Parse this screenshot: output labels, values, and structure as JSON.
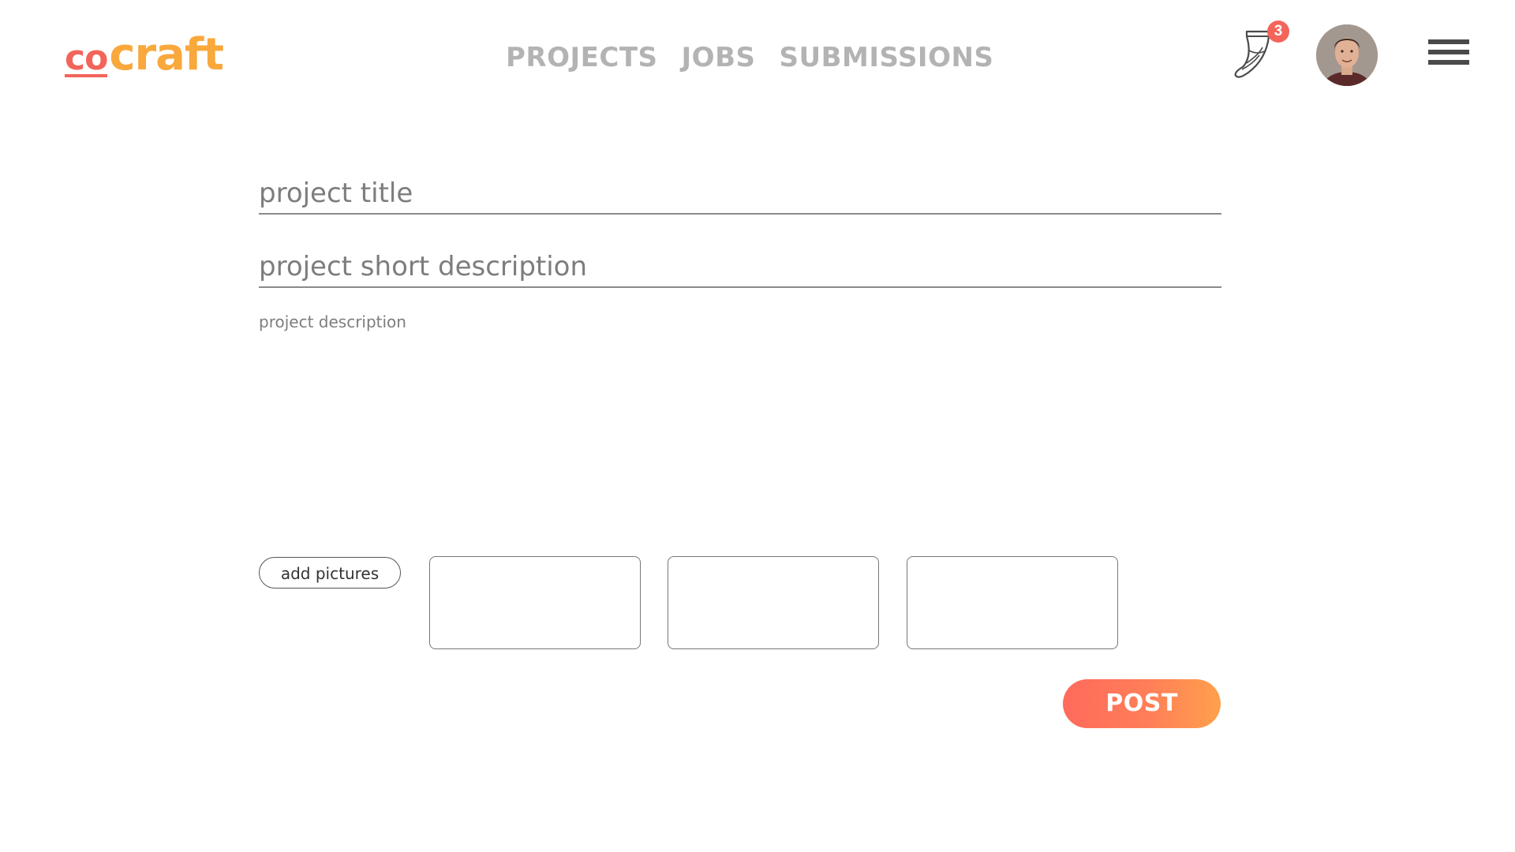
{
  "brand": {
    "logo_part1": "co",
    "logo_part2": "craft",
    "color_primary": "#f3645a",
    "color_secondary": "#f9a83c"
  },
  "nav": {
    "items": [
      {
        "label": "PROJECTS"
      },
      {
        "label": "JOBS"
      },
      {
        "label": "SUBMISSIONS"
      }
    ]
  },
  "header": {
    "notifications_icon": "horn-icon",
    "notifications_count": "3",
    "avatar_icon": "user-avatar",
    "menu_icon": "hamburger-menu-icon"
  },
  "form": {
    "title_placeholder": "project title",
    "title_value": "",
    "short_description_placeholder": "project short description",
    "short_description_value": "",
    "description_placeholder": "project description",
    "description_value": "",
    "add_pictures_label": "add pictures",
    "picture_slot_count": 3,
    "post_label": "POST",
    "post_gradient": [
      "#ff6a5c",
      "#ffa04c"
    ]
  }
}
